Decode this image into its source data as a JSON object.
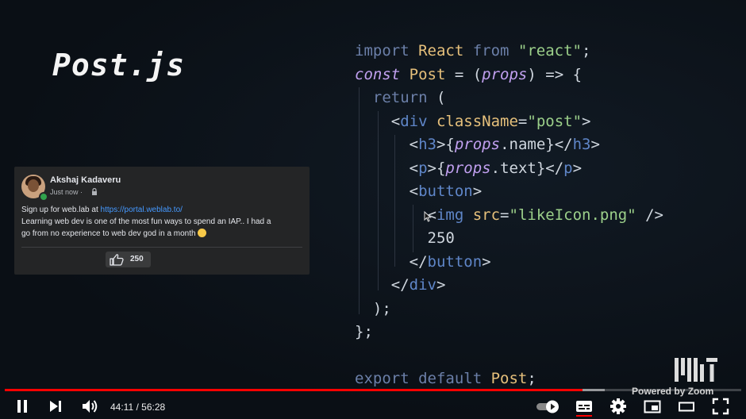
{
  "slide": {
    "title": "Post.js"
  },
  "post": {
    "author": "Akshaj Kadaveru",
    "time": "Just now · ",
    "line1_prefix": "Sign up for web.lab at ",
    "line1_link": "https://portal.weblab.to/",
    "line2": "Learning web dev is one of the most fun ways to spend an IAP.. I had a",
    "line3": "go from no experience to web dev god in a month ",
    "like_count": "250"
  },
  "code_lines": [
    [
      [
        "kw",
        "import "
      ],
      [
        "id",
        "React "
      ],
      [
        "kw",
        "from "
      ],
      [
        "str",
        "\"react\""
      ],
      [
        "pun",
        ";"
      ]
    ],
    [
      [
        "kwi",
        "const "
      ],
      [
        "id",
        "Post "
      ],
      [
        "pun",
        "= ("
      ],
      [
        "kwi",
        "props"
      ],
      [
        "pun",
        ") => {"
      ]
    ],
    [
      [
        "pun",
        "  "
      ],
      [
        "kw",
        "return "
      ],
      [
        "pun",
        "("
      ]
    ],
    [
      [
        "pun",
        "    <"
      ],
      [
        "tag",
        "div "
      ],
      [
        "id",
        "className"
      ],
      [
        "pun",
        "="
      ],
      [
        "str",
        "\"post\""
      ],
      [
        "pun",
        ">"
      ]
    ],
    [
      [
        "pun",
        "      <"
      ],
      [
        "tag",
        "h3"
      ],
      [
        "pun",
        ">{"
      ],
      [
        "kwi",
        "props"
      ],
      [
        "pun",
        ".name}</"
      ],
      [
        "tag",
        "h3"
      ],
      [
        "pun",
        ">"
      ]
    ],
    [
      [
        "pun",
        "      <"
      ],
      [
        "tag",
        "p"
      ],
      [
        "pun",
        ">{"
      ],
      [
        "kwi",
        "props"
      ],
      [
        "pun",
        ".text}</"
      ],
      [
        "tag",
        "p"
      ],
      [
        "pun",
        ">"
      ]
    ],
    [
      [
        "pun",
        "      <"
      ],
      [
        "tag",
        "button"
      ],
      [
        "pun",
        ">"
      ]
    ],
    [
      [
        "pun",
        "        <"
      ],
      [
        "tag",
        "img "
      ],
      [
        "id",
        "src"
      ],
      [
        "pun",
        "="
      ],
      [
        "str",
        "\"likeIcon.png\" "
      ],
      [
        "pun",
        "/>"
      ]
    ],
    [
      [
        "pun",
        "        250"
      ]
    ],
    [
      [
        "pun",
        "      </"
      ],
      [
        "tag",
        "button"
      ],
      [
        "pun",
        ">"
      ]
    ],
    [
      [
        "pun",
        "    </"
      ],
      [
        "tag",
        "div"
      ],
      [
        "pun",
        ">"
      ]
    ],
    [
      [
        "pun",
        "  );"
      ]
    ],
    [
      [
        "pun",
        "};"
      ]
    ],
    [
      [
        "pun",
        ""
      ]
    ],
    [
      [
        "kw",
        "export default "
      ],
      [
        "id",
        "Post"
      ],
      [
        "pun",
        ";"
      ]
    ]
  ],
  "branding": {
    "powered_by": "Powered by Zoom"
  },
  "player": {
    "time": "44:11 / 56:28",
    "progress": 0.785,
    "buffered": 0.815,
    "buttons": [
      "pause-icon",
      "next-icon",
      "volume-icon",
      "autoplay-toggle-icon",
      "subtitles-icon",
      "settings-icon",
      "miniplayer-icon",
      "theater-mode-icon",
      "fullscreen-icon"
    ]
  },
  "colors": {
    "progress": "#ff0000",
    "link": "#4599ff",
    "card": "#242526"
  }
}
